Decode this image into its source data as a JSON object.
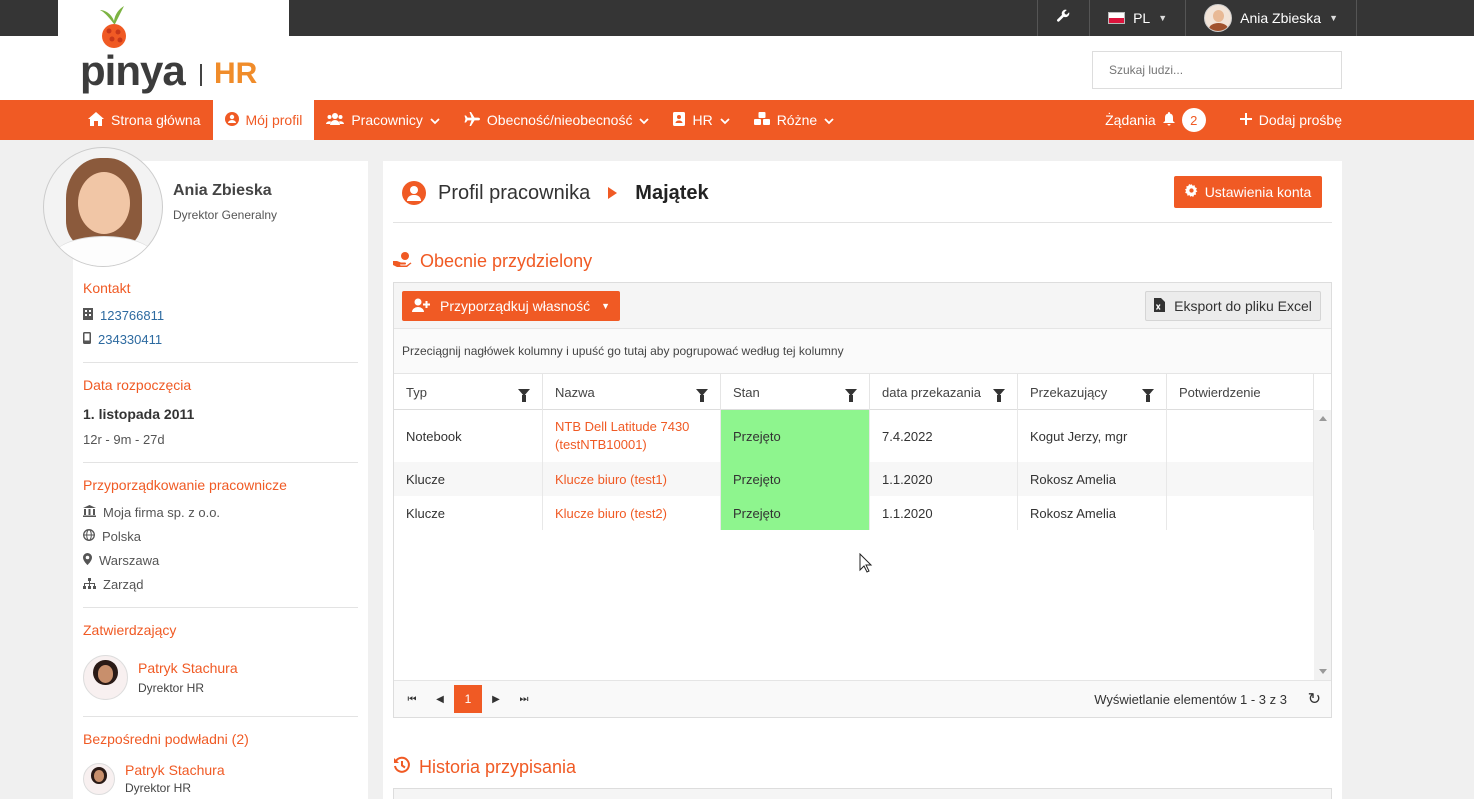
{
  "topbar": {
    "language": "PL",
    "user_name": "Ania Zbieska"
  },
  "brand": {
    "logo_text": "pinya",
    "logo_suffix": "HR"
  },
  "search": {
    "placeholder": "Szukaj ludzi..."
  },
  "nav": {
    "items": [
      {
        "label": "Strona główna",
        "icon": "home-icon"
      },
      {
        "label": "Mój profil",
        "icon": "user-circle-icon"
      },
      {
        "label": "Pracownicy",
        "icon": "users-icon"
      },
      {
        "label": "Obecność/nieobecność",
        "icon": "plane-icon"
      },
      {
        "label": "HR",
        "icon": "address-book-icon"
      },
      {
        "label": "Różne",
        "icon": "cubes-icon"
      }
    ],
    "requests_label": "Żądania",
    "requests_count": "2",
    "add_request_label": "Dodaj prośbę"
  },
  "profile": {
    "name": "Ania Zbieska",
    "title": "Dyrektor Generalny",
    "contact_heading": "Kontakt",
    "phone1": "123766811",
    "phone2": "234330411",
    "start_heading": "Data rozpoczęcia",
    "start_date": "1. listopada 2011",
    "tenure": "12r - 9m - 27d",
    "assignment_heading": "Przyporządkowanie pracownicze",
    "company": "Moja firma sp. z o.o.",
    "country": "Polska",
    "city": "Warszawa",
    "department": "Zarząd",
    "approver_heading": "Zatwierdzający",
    "approver_name": "Patryk Stachura",
    "approver_role": "Dyrektor HR",
    "subordinates_heading": "Bezpośredni podwładni (2)",
    "sub1_name": "Patryk Stachura",
    "sub1_role": "Dyrektor HR"
  },
  "main": {
    "breadcrumb_parent": "Profil pracownika",
    "breadcrumb_current": "Majątek",
    "settings_button": "Ustawienia konta",
    "section1_title": "Obecnie przydzielony",
    "assign_button": "Przyporządkuj własność",
    "export_button": "Eksport do pliku Excel",
    "group_hint": "Przeciągnij nagłówek kolumny i upuść go tutaj aby pogrupować według tej kolumny",
    "columns": [
      "Typ",
      "Nazwa",
      "Stan",
      "data przekazania",
      "Przekazujący",
      "Potwierdzenie"
    ],
    "rows": [
      {
        "typ": "Notebook",
        "nazwa": "NTB Dell Latitude 7430 (testNTB10001)",
        "stan": "Przejęto",
        "data": "7.4.2022",
        "przekazujacy": "Kogut Jerzy, mgr",
        "potwierdzenie": ""
      },
      {
        "typ": "Klucze",
        "nazwa": "Klucze biuro (test1)",
        "stan": "Przejęto",
        "data": "1.1.2020",
        "przekazujacy": "Rokosz Amelia",
        "potwierdzenie": ""
      },
      {
        "typ": "Klucze",
        "nazwa": "Klucze biuro (test2)",
        "stan": "Przejęto",
        "data": "1.1.2020",
        "przekazujacy": "Rokosz Amelia",
        "potwierdzenie": ""
      }
    ],
    "current_page": "1",
    "pager_info": "Wyświetlanie elementów 1 - 3 z 3",
    "section2_title": "Historia przypisania"
  },
  "colors": {
    "accent": "#f05a24",
    "status_green": "#8ef58e",
    "topbar": "#353535",
    "logo_hr": "#f08c2a"
  }
}
